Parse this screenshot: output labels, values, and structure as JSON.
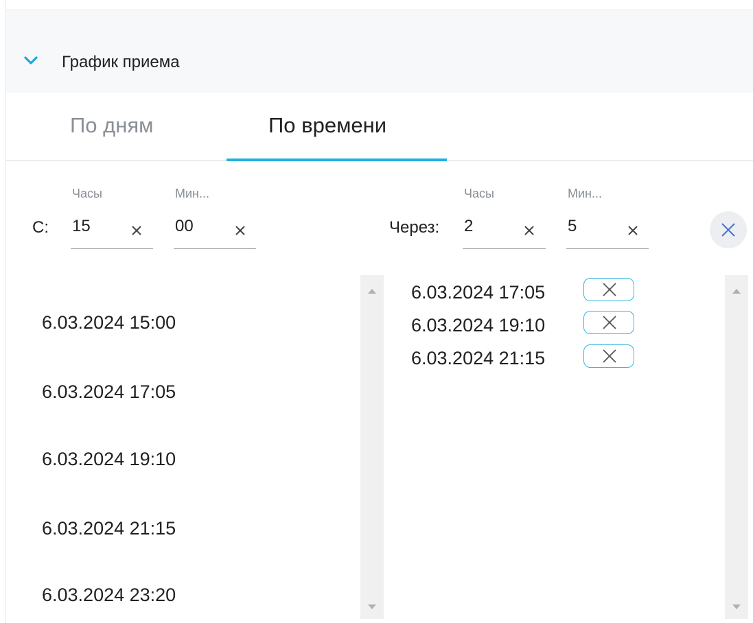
{
  "section": {
    "title": "График приема",
    "icon": "chevron-down-icon"
  },
  "tabs": [
    {
      "label": "По дням",
      "active": false
    },
    {
      "label": "По времени",
      "active": true
    }
  ],
  "from": {
    "prefix": "С:",
    "hours_label": "Часы",
    "hours_value": "15",
    "minutes_label": "Мин...",
    "minutes_value": "00"
  },
  "interval": {
    "prefix": "Через:",
    "hours_label": "Часы",
    "hours_value": "2",
    "minutes_label": "Мин...",
    "minutes_value": "5"
  },
  "generated_times": [
    "6.03.2024 15:00",
    "6.03.2024 17:05",
    "6.03.2024 19:10",
    "6.03.2024 21:15",
    "6.03.2024 23:20"
  ],
  "selected_times": [
    "6.03.2024 17:05",
    "6.03.2024 19:10",
    "6.03.2024 21:15"
  ],
  "colors": {
    "accent": "#1fb0e0",
    "chevron": "#1fa7d8",
    "chip_border": "#35b5e3"
  }
}
